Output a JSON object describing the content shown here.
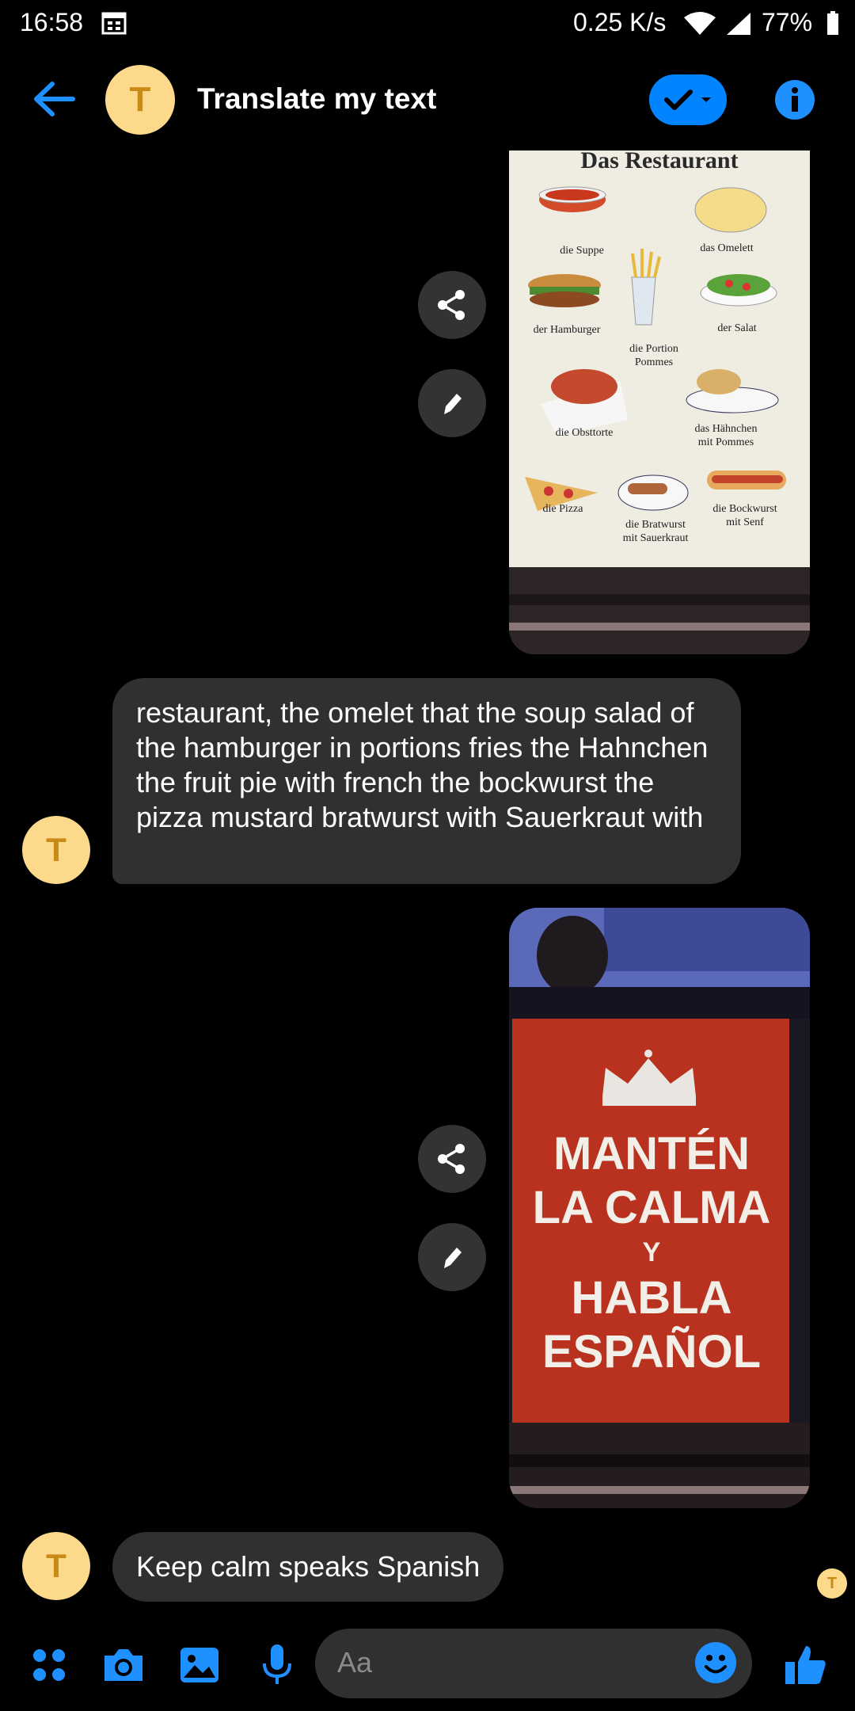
{
  "status_bar": {
    "time": "16:58",
    "speed": "0.25 K/s",
    "battery": "77%"
  },
  "header": {
    "avatar_letter": "T",
    "title": "Translate my text"
  },
  "messages": {
    "image1": {
      "title": "Das Restaurant",
      "labels": [
        "die Suppe",
        "das Omelett",
        "der Hamburger",
        "der Salat",
        "die Portion",
        "Pommes",
        "die Obsttorte",
        "das Hähnchen",
        "mit Pommes",
        "die Pizza",
        "die Bratwurst",
        "mit Sauerkraut",
        "die Bockwurst",
        "mit Senf"
      ]
    },
    "reply1": "restaurant, the omelet that the soup salad of the hamburger in portions fries the Hahnchen the fruit pie with french the bockwurst the pizza mustard bratwurst with Sauerkraut with",
    "image2": {
      "lines": [
        "MANTÉN",
        "LA CALMA",
        "Y",
        "HABLA",
        "ESPAÑOL"
      ]
    },
    "reply2": "Keep calm speaks Spanish",
    "avatar_letter": "T"
  },
  "composer": {
    "placeholder": "Aa"
  }
}
